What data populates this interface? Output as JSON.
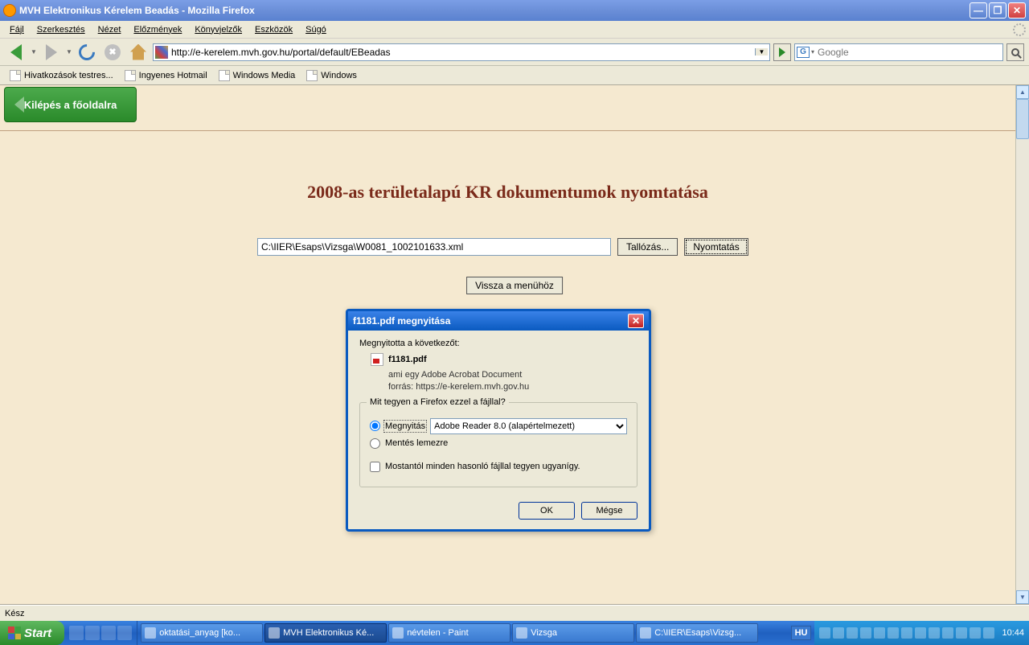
{
  "titlebar": {
    "text": "MVH Elektronikus Kérelem Beadás - Mozilla Firefox"
  },
  "menus": {
    "file": "Fájl",
    "edit": "Szerkesztés",
    "view": "Nézet",
    "history": "Előzmények",
    "bookmarks": "Könyvjelzők",
    "tools": "Eszközök",
    "help": "Súgó"
  },
  "url": "http://e-kerelem.mvh.gov.hu/portal/default/EBeadas",
  "search_placeholder": "Google",
  "bookmarks": {
    "b1": "Hivatkozások testres...",
    "b2": "Ingyenes Hotmail",
    "b3": "Windows Media",
    "b4": "Windows"
  },
  "page": {
    "exit": "Kilépés a főoldalra",
    "heading": "2008-as területalapú KR dokumentumok nyomtatása",
    "filepath": "C:\\IIER\\Esaps\\Vizsga\\W0081_1002101633.xml",
    "browse": "Tallózás...",
    "print": "Nyomtatás",
    "back": "Vissza a menühöz"
  },
  "dialog": {
    "title": "f1181.pdf megnyitása",
    "opened": "Megnyitotta a következőt:",
    "filename": "f1181.pdf",
    "type_label": "ami egy",
    "type_value": "Adobe Acrobat Document",
    "source_label": "forrás:",
    "source_value": "https://e-kerelem.mvh.gov.hu",
    "question": "Mit tegyen a Firefox ezzel a fájllal?",
    "open": "Megnyitás",
    "open_with": "Adobe Reader 8.0 (alapértelmezett)",
    "save": "Mentés lemezre",
    "remember": "Mostantól minden hasonló fájllal tegyen ugyanígy.",
    "ok": "OK",
    "cancel": "Mégse"
  },
  "status": "Kész",
  "taskbar": {
    "start": "Start",
    "t1": "oktatási_anyag [ko...",
    "t2": "MVH Elektronikus Ké...",
    "t3": "névtelen - Paint",
    "t4": "Vizsga",
    "t5": "C:\\IIER\\Esaps\\Vizsg...",
    "lang": "HU",
    "clock": "10:44"
  }
}
